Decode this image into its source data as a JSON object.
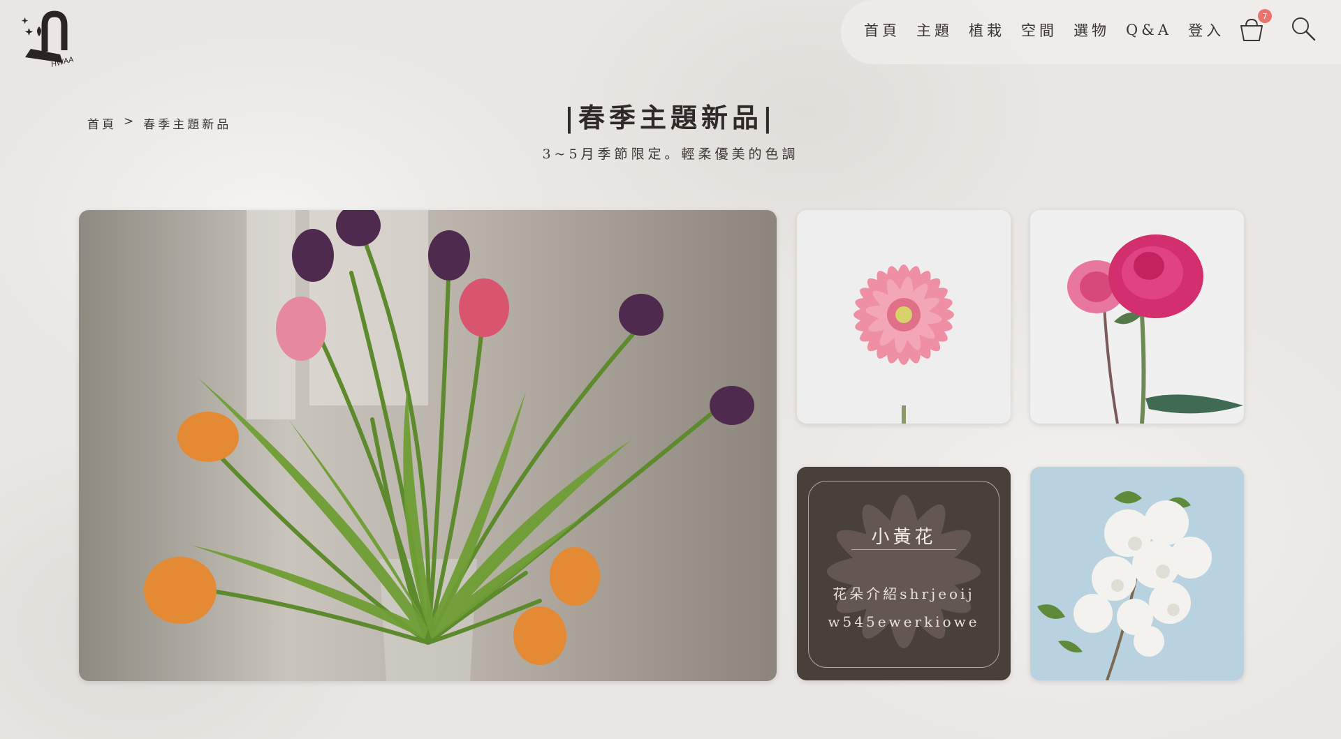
{
  "logo": {
    "text": "HWAA"
  },
  "nav": {
    "items": [
      "首頁",
      "主題",
      "植栽",
      "空間",
      "選物",
      "Q&A",
      "登入"
    ],
    "cart_count": "7"
  },
  "breadcrumb": {
    "home": "首頁",
    "separator": ">",
    "current": "春季主題新品"
  },
  "page": {
    "title": "|春季主題新品|",
    "subtitle": "3~5月季節限定。輕柔優美的色調"
  },
  "cards": {
    "overlay_title": "小黃花",
    "overlay_line1": "花朵介紹shrjeoij",
    "overlay_line2": "w545ewerkiowe"
  },
  "colors": {
    "background": "#e9e6e3",
    "text": "#3b3634",
    "badge": "#e8736f",
    "overlay_card": "#4a403a"
  }
}
